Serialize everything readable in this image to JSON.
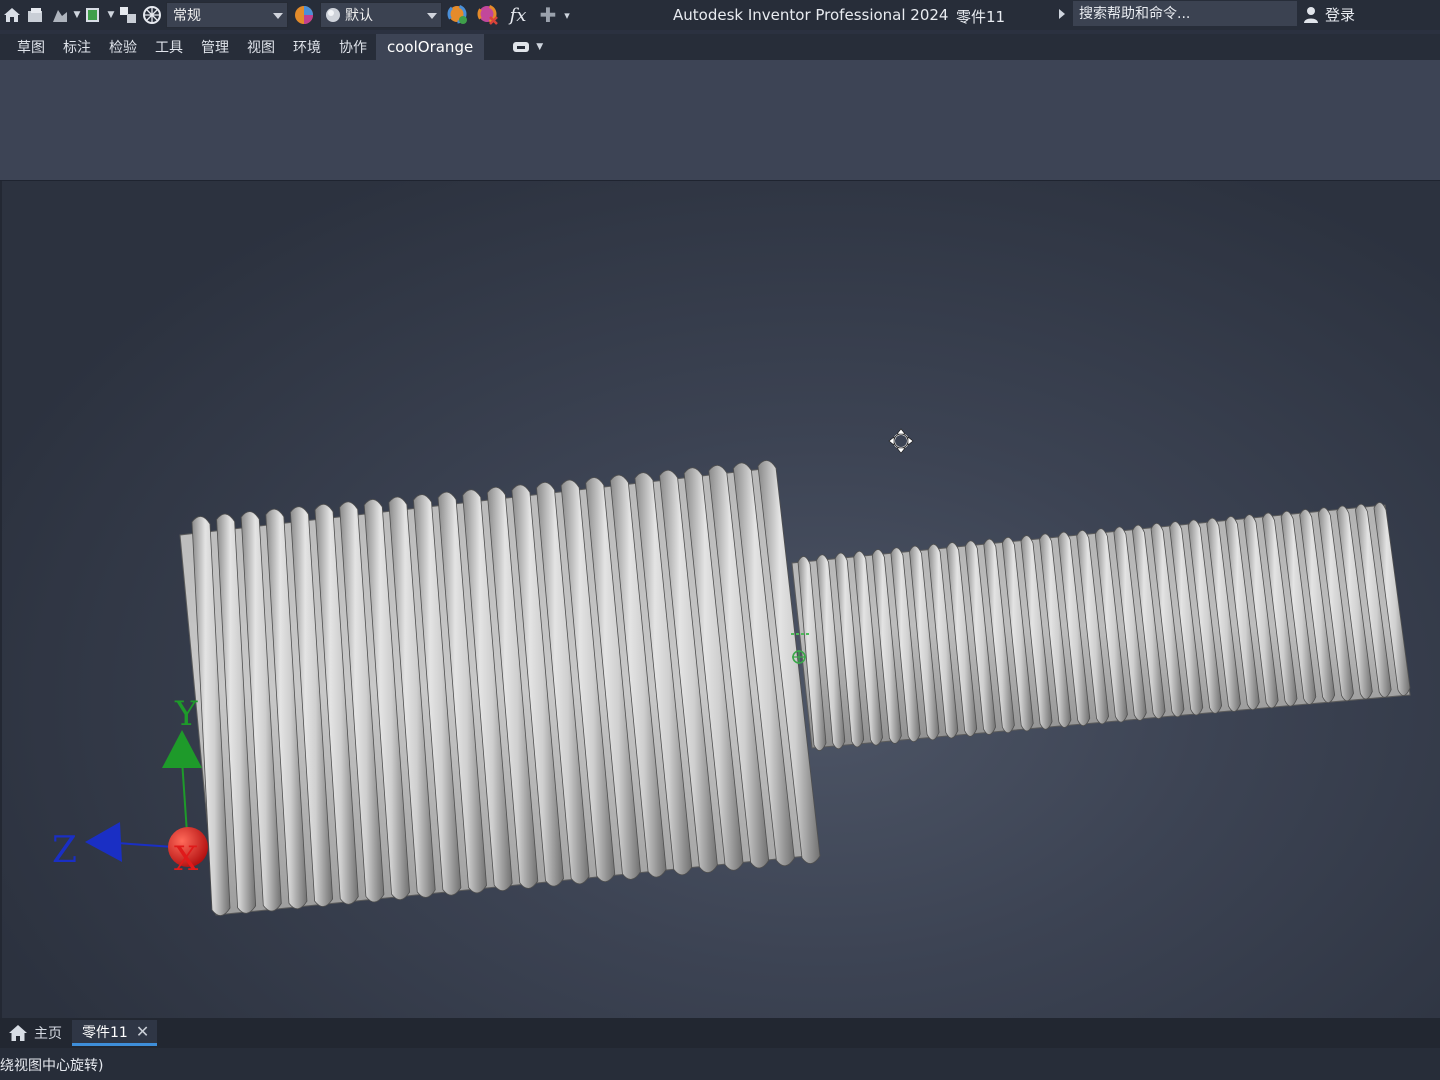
{
  "titlebar": {
    "style_value": "常规",
    "appearance_value": "默认",
    "app_title": "Autodesk Inventor Professional 2024",
    "doc_title": "零件11",
    "search_placeholder": "搜索帮助和命令...",
    "login_label": "登录"
  },
  "ribbon": {
    "tabs": [
      "草图",
      "标注",
      "检验",
      "工具",
      "管理",
      "视图",
      "环境",
      "协作",
      "coolOrange"
    ],
    "active_tab_index": 8
  },
  "viewport": {
    "axis_labels": {
      "x": "X",
      "y": "Y",
      "z": "Z"
    },
    "axis_colors": {
      "x": "#d21b1b",
      "y": "#1e9a2a",
      "z": "#1a2fc4"
    },
    "model_color": "#c9c9c9"
  },
  "document_tabs": {
    "home_label": "主页",
    "part_label": "零件11",
    "close_glyph": "✕"
  },
  "status": {
    "text": "绕视图中心旋转)"
  },
  "icons": [
    "home-icon",
    "open-icon",
    "save-icon",
    "undo-icon",
    "select-icon",
    "update-icon",
    "material-icon",
    "appearance-icon",
    "color-override-icon",
    "clear-appearance-icon",
    "function-icon",
    "add-icon",
    "customize-icon",
    "user-icon",
    "orbit-cursor-icon"
  ]
}
